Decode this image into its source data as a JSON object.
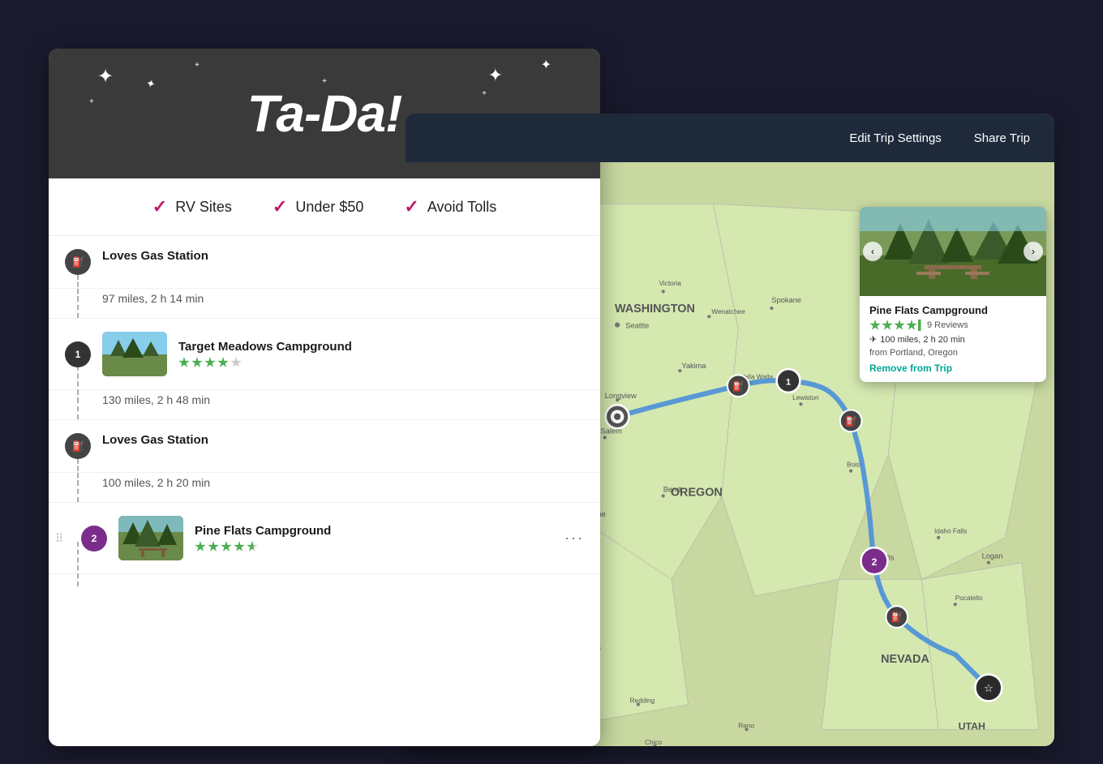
{
  "header": {
    "tada_title": "Ta-Da!",
    "edit_trip_label": "Edit Trip Settings",
    "share_trip_label": "Share Trip"
  },
  "checks": [
    {
      "id": "rv",
      "label": "RV Sites"
    },
    {
      "id": "price",
      "label": "Under $50"
    },
    {
      "id": "tolls",
      "label": "Avoid Tolls"
    }
  ],
  "itinerary": [
    {
      "type": "gas",
      "marker": "⛽",
      "title": "Loves Gas Station",
      "distance": "97 miles, 2 h 14 min",
      "has_thumb": false
    },
    {
      "type": "camp",
      "marker": "1",
      "title": "Target Meadows Campground",
      "distance": "130 miles, 2 h 48 min",
      "has_thumb": true,
      "thumb_class": "thumb-meadows",
      "stars": 4,
      "max_stars": 5
    },
    {
      "type": "gas",
      "marker": "⛽",
      "title": "Loves Gas Station",
      "distance": "100 miles, 2 h 20 min",
      "has_thumb": false
    },
    {
      "type": "camp",
      "marker": "2",
      "title": "Pine Flats Campground",
      "distance": "",
      "has_thumb": true,
      "thumb_class": "thumb-pineflats",
      "stars": 4,
      "max_stars": 5,
      "show_dots": true
    }
  ],
  "popup": {
    "title": "Pine Flats Campground",
    "stars": 4,
    "max_stars": 5,
    "reviews": "9 Reviews",
    "distance": "100 miles, 2 h 20 min",
    "from": "from Portland, Oregon",
    "remove_label": "Remove from Trip"
  },
  "colors": {
    "accent_pink": "#c0196c",
    "accent_teal": "#00a896",
    "dark_header": "#3a3a3a",
    "nav_dark": "#1e2a3a",
    "camp2_purple": "#7b2d8b"
  }
}
